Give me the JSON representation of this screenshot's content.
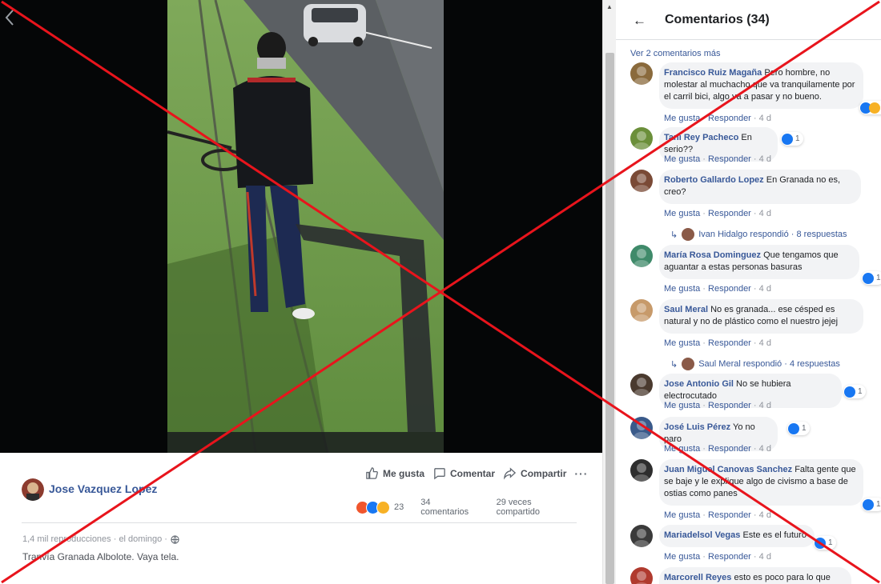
{
  "post": {
    "poster_name": "Jose Vazquez Lopez",
    "actions": {
      "like": "Me gusta",
      "comment": "Comentar",
      "share": "Compartir",
      "more": "···"
    },
    "reactions_count": "23",
    "comments_count": "34 comentarios",
    "shares_count": "29 veces compartido",
    "meta": "1,4 mil reproducciones · el domingo ·",
    "caption": "Tranvía Granada Albolote. Vaya tela."
  },
  "comments_panel": {
    "title": "Comentarios (34)",
    "view_more": "Ver 2 comentarios más",
    "action_like": "Me gusta",
    "action_reply": "Responder",
    "comments": [
      {
        "author": "Francisco Ruiz Magaña",
        "text": "Pero hombre, no molestar al muchacho que va tranquilamente por el carril bici, algo va a pasar y no bueno.",
        "time": "4 d",
        "reactions": "2",
        "avatar_color": "#8a6a3c"
      },
      {
        "author": "Tani Rey Pacheco",
        "text": "En serio??",
        "time": "4 d",
        "reactions": "1",
        "avatar_color": "#6b8f3a"
      },
      {
        "author": "Roberto Gallardo Lopez",
        "text": "En Granada no es, creo?",
        "time": "4 d",
        "reactions": "",
        "avatar_color": "#7a4a36",
        "reply_line": "Ivan Hidalgo respondió · 8 respuestas"
      },
      {
        "author": "María Rosa Dominguez",
        "text": "Que tengamos que aguantar a estas personas basuras",
        "time": "4 d",
        "reactions": "1",
        "avatar_color": "#3f8a6a"
      },
      {
        "author": "Saul Meral",
        "text": "No es granada... ese césped es natural y no de plástico como el nuestro jejej",
        "time": "4 d",
        "reactions": "",
        "avatar_color": "#c79a6a",
        "reply_line": "Saul Meral respondió · 4 respuestas"
      },
      {
        "author": "Jose Antonio Gil",
        "text": "No se hubiera electrocutado",
        "time": "4 d",
        "reactions": "1",
        "avatar_color": "#4a3a2e"
      },
      {
        "author": "José Luis Pérez",
        "text": "Yo no paro",
        "time": "4 d",
        "reactions": "1",
        "avatar_color": "#3a5a8a"
      },
      {
        "author": "Juan Miguel Canovas Sanchez",
        "text": "Falta gente que se baje y le explique algo de civismo a base de ostias como panes",
        "time": "4 d",
        "reactions": "1",
        "avatar_color": "#2e2e2e"
      },
      {
        "author": "Mariadelsol Vegas",
        "text": "Este es el futuro",
        "time": "4 d",
        "reactions": "1",
        "avatar_color": "#3a3a3a"
      },
      {
        "author": "Marcorell Reyes",
        "text": "esto es poco para lo que nos",
        "time": "",
        "reactions": "",
        "avatar_color": "#b03a2e"
      }
    ]
  },
  "colors": {
    "link_blue": "#385898",
    "overlay_red": "#e8141c",
    "like_blue": "#1877f2",
    "angry_orange": "#f0562d",
    "wow_yellow": "#f7b125"
  }
}
